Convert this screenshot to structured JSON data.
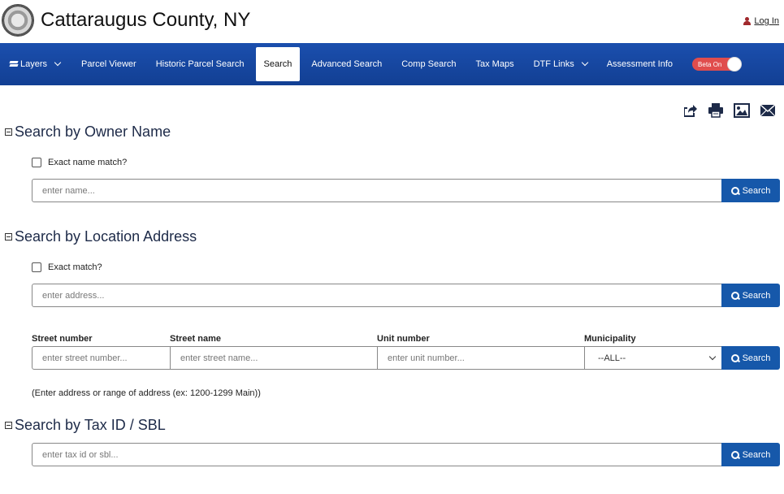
{
  "header": {
    "title": "Cattaraugus County, NY",
    "login_label": "Log In"
  },
  "nav": {
    "items": [
      {
        "label": "Layers",
        "dropdown": true
      },
      {
        "label": "Parcel Viewer"
      },
      {
        "label": "Historic Parcel Search"
      },
      {
        "label": "Search",
        "active": true
      },
      {
        "label": "Advanced Search"
      },
      {
        "label": "Comp Search"
      },
      {
        "label": "Tax Maps"
      },
      {
        "label": "DTF Links",
        "dropdown": true
      },
      {
        "label": "Assessment Info"
      }
    ],
    "beta_toggle_label": "Beta On"
  },
  "toolbar": {
    "icons": [
      "share-icon",
      "print-icon",
      "image-icon",
      "email-icon"
    ]
  },
  "owner_section": {
    "heading": "Search by Owner Name",
    "checkbox_label": "Exact name match?",
    "placeholder": "enter name...",
    "button_label": "Search"
  },
  "address_section": {
    "heading": "Search by Location Address",
    "checkbox_label": "Exact match?",
    "placeholder": "enter address...",
    "button_label": "Search",
    "street_number_label": "Street number",
    "street_number_placeholder": "enter street number...",
    "street_name_label": "Street name",
    "street_name_placeholder": "enter street name...",
    "unit_number_label": "Unit number",
    "unit_number_placeholder": "enter unit number...",
    "municipality_label": "Municipality",
    "municipality_value": "--ALL--",
    "button2_label": "Search",
    "hint": "(Enter address or range of address (ex: 1200-1299 Main))"
  },
  "taxid_section": {
    "heading": "Search by Tax ID / SBL",
    "placeholder": "enter tax id or sbl...",
    "button_label": "Search"
  },
  "colors": {
    "nav_bg": "#1b4fae",
    "button_bg": "#1658aa",
    "toggle_bg": "#e04d4d"
  }
}
